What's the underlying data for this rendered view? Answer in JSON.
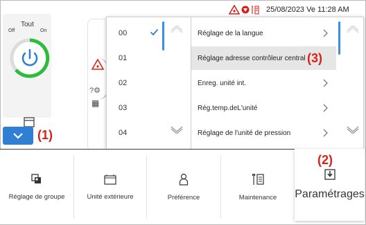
{
  "status_bar": {
    "datetime": "25/08/2023 Ve 11:28 AM"
  },
  "background": {
    "group_label": "Tout",
    "off_label": "Off",
    "on_label": "On",
    "schedule_label": "timing"
  },
  "popup": {
    "numbers": [
      {
        "label": "00",
        "checked": true
      },
      {
        "label": "01",
        "checked": false
      },
      {
        "label": "02",
        "checked": false
      },
      {
        "label": "03",
        "checked": false
      },
      {
        "label": "04",
        "checked": false
      }
    ],
    "settings": [
      {
        "label": "Réglage de la langue",
        "selected": false
      },
      {
        "label": "Réglage adresse contrôleur central",
        "selected": true
      },
      {
        "label": "Enreg. unité int.",
        "selected": false
      },
      {
        "label": "Rég.temp.deL'unité",
        "selected": false
      },
      {
        "label": "Réglage de l'unité de pression",
        "selected": false
      }
    ]
  },
  "bottom_nav": [
    {
      "label": "Réglage de groupe",
      "icon": "group-settings-icon"
    },
    {
      "label": "Unité extérieure",
      "icon": "outdoor-unit-icon"
    },
    {
      "label": "Préférence",
      "icon": "preference-icon"
    },
    {
      "label": "Maintenance",
      "icon": "maintenance-icon"
    },
    {
      "label": "Paramétrages",
      "icon": "settings-download-icon",
      "active": true
    }
  ],
  "callouts": {
    "c1": "(1)",
    "c2": "(2)",
    "c3": "(3)"
  },
  "colors": {
    "accent": "#2f7fd4",
    "callout": "#d6221a",
    "alarm": "#d6221a",
    "power_ring": "#2ebd3a"
  }
}
